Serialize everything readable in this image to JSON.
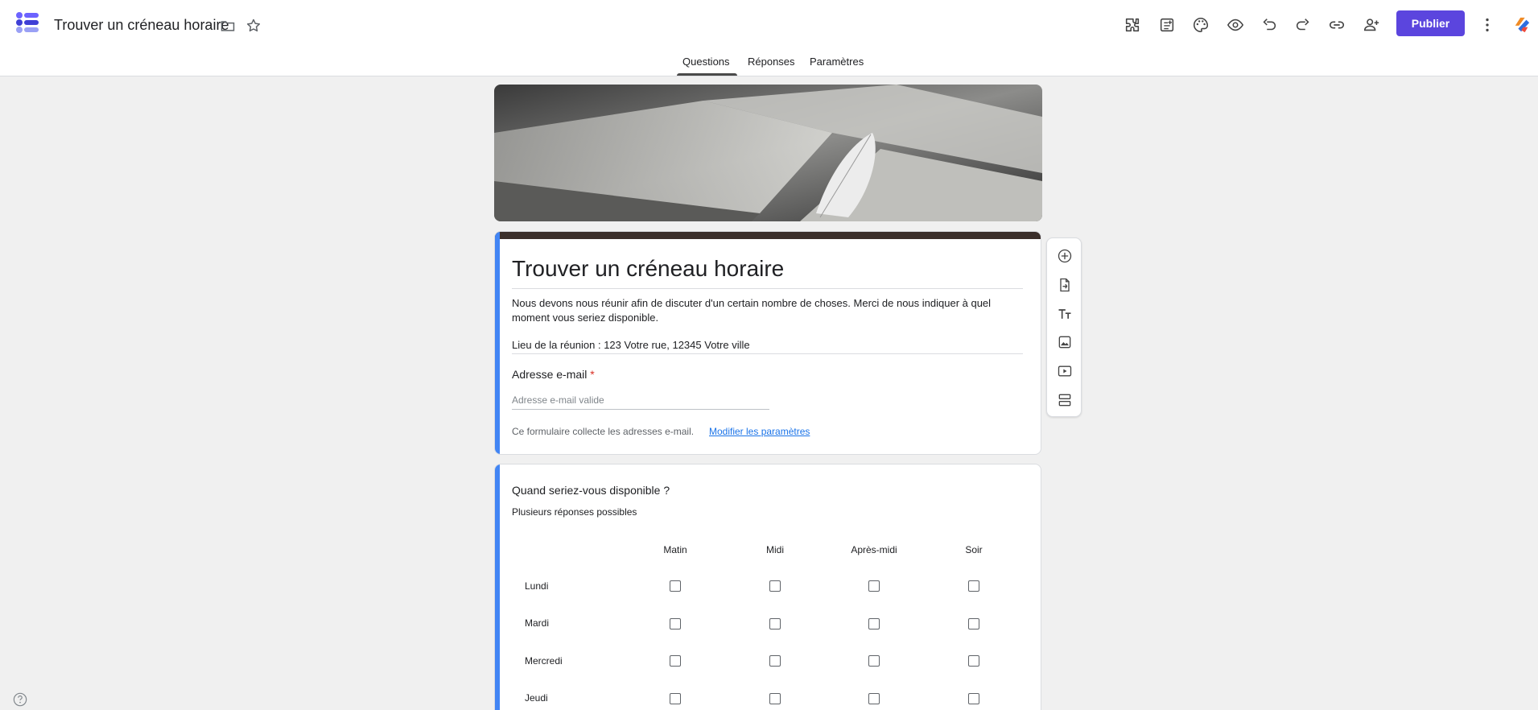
{
  "header": {
    "doc_title": "Trouver un créneau horaire",
    "publish_label": "Publier",
    "brand_color": "#5b45de",
    "icons": [
      "addons-icon",
      "quiz-settings-icon",
      "palette-icon",
      "preview-icon",
      "undo-icon",
      "redo-icon",
      "link-icon",
      "add-collaborator-icon",
      "more-options-icon",
      "account-avatar-icon"
    ]
  },
  "tabs": [
    {
      "label": "Questions",
      "active": true
    },
    {
      "label": "Réponses",
      "active": false
    },
    {
      "label": "Paramètres",
      "active": false
    }
  ],
  "form": {
    "title": "Trouver un créneau horaire",
    "description": "Nous devons nous réunir afin de discuter d'un certain nombre de choses. Merci de nous indiquer à quel moment vous seriez disponible.",
    "location": "Lieu de la réunion : 123 Votre rue, 12345 Votre ville",
    "email_label": "Adresse e-mail",
    "email_required_mark": "*",
    "email_placeholder": "Adresse e-mail valide",
    "collect_note": "Ce formulaire collecte les adresses e-mail.",
    "settings_link": "Modifier les paramètres",
    "accent_color": "#4285f4"
  },
  "question": {
    "title": "Quand seriez-vous disponible ?",
    "subtitle": "Plusieurs réponses possibles",
    "columns": [
      "Matin",
      "Midi",
      "Après-midi",
      "Soir"
    ],
    "rows": [
      "Lundi",
      "Mardi",
      "Mercredi",
      "Jeudi"
    ]
  },
  "side_toolbar": {
    "icons": [
      "add-question-icon",
      "import-questions-icon",
      "add-title-icon",
      "add-image-icon",
      "add-video-icon",
      "add-section-icon"
    ]
  }
}
